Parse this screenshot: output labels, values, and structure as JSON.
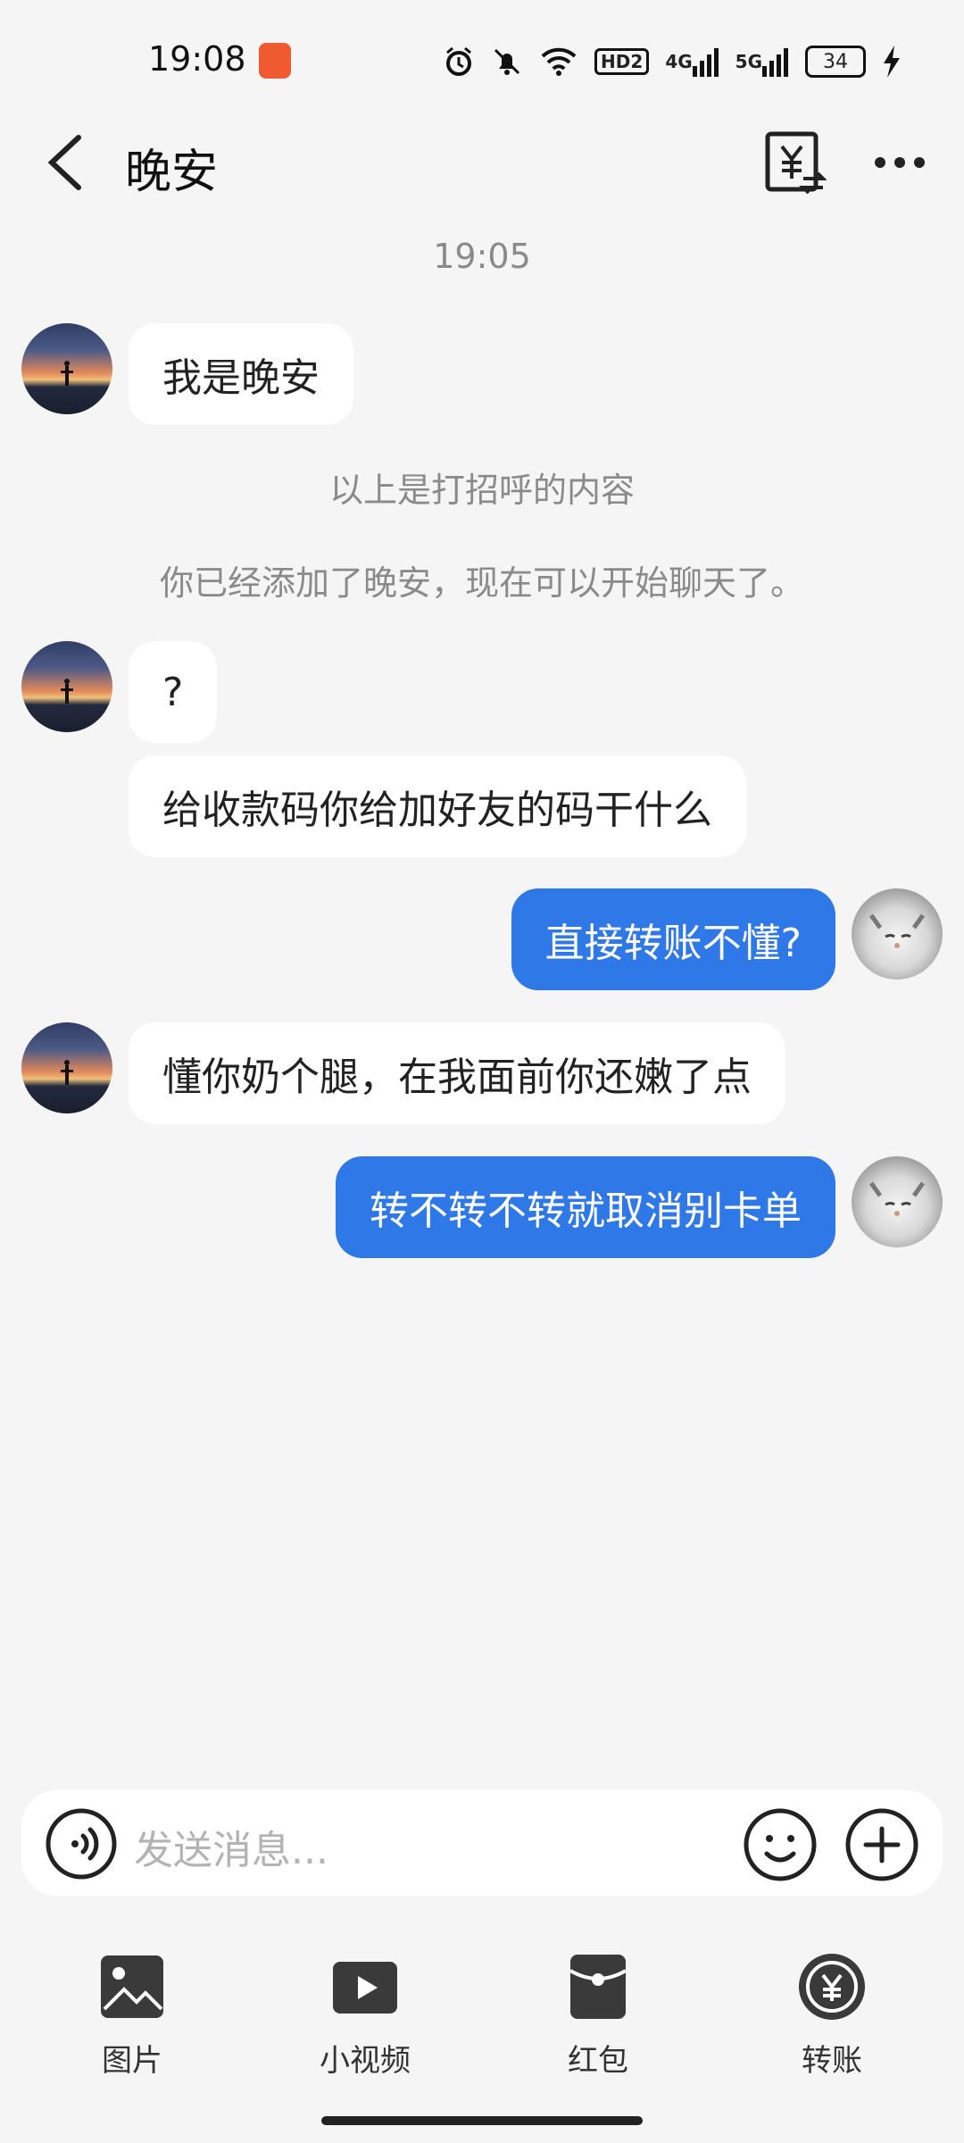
{
  "status_bar": {
    "time": "19:08",
    "icons": [
      "alarm-icon",
      "mute-icon",
      "wifi-icon",
      "hd-icon",
      "signal-4g-icon",
      "signal-5g-icon"
    ],
    "hd_label": "HD2",
    "net1": "4G",
    "net2": "5G",
    "battery": "34"
  },
  "header": {
    "title": "晚安",
    "transfer_icon": "yuan-transfer-icon",
    "more_icon": "more-icon"
  },
  "chat": {
    "timestamp": "19:05",
    "messages": [
      {
        "from": "other",
        "text": "我是晚安"
      },
      {
        "system": "以上是打招呼的内容"
      },
      {
        "system": "你已经添加了晚安，现在可以开始聊天了。"
      },
      {
        "from": "other",
        "text": "?"
      },
      {
        "from": "other",
        "text": "给收款码你给加好友的码干什么"
      },
      {
        "from": "self",
        "text": "直接转账不懂?"
      },
      {
        "from": "other",
        "text": "懂你奶个腿，在我面前你还嫩了点"
      },
      {
        "from": "self",
        "text": "转不转不转就取消别卡单"
      }
    ]
  },
  "input": {
    "placeholder": "发送消息..."
  },
  "toolbar": {
    "items": [
      {
        "label": "图片",
        "icon": "image-icon"
      },
      {
        "label": "小视频",
        "icon": "video-icon"
      },
      {
        "label": "红包",
        "icon": "red-packet-icon"
      },
      {
        "label": "转账",
        "icon": "transfer-icon"
      }
    ]
  },
  "colors": {
    "accent": "#2f78e8",
    "background": "#f5f5f5"
  }
}
